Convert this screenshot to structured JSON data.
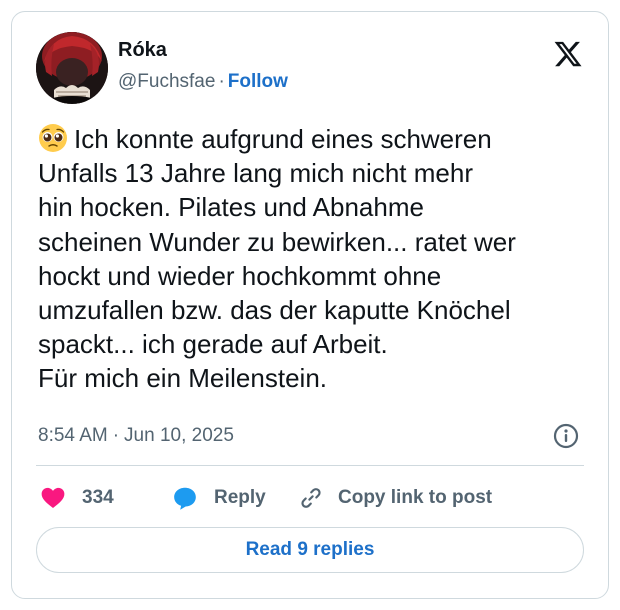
{
  "author": {
    "name": "Róka",
    "handle": "@Fuchsfae",
    "separator": "·",
    "follow_label": "Follow"
  },
  "brand_icon": "x-logo-icon",
  "tweet": {
    "emoji": "pleading-face-emoji",
    "lines": [
      "Ich konnte aufgrund eines schweren",
      "Unfalls 13 Jahre lang mich nicht mehr",
      "hin hocken. Pilates und Abnahme",
      "scheinen Wunder zu bewirken... ratet wer",
      "hockt und wieder hochkommt ohne",
      "umzufallen bzw. das der kaputte Knöchel",
      "spackt... ich gerade auf Arbeit.",
      "Für mich ein Meilenstein."
    ]
  },
  "meta": {
    "time": "8:54 AM",
    "separator": "·",
    "date": "Jun 10, 2025"
  },
  "actions": {
    "like_count": "334",
    "reply_label": "Reply",
    "copy_label": "Copy link to post"
  },
  "read_replies_label": "Read 9 replies",
  "colors": {
    "accent": "#1d70c9",
    "like": "#f91880",
    "reply_icon": "#1d9bf0",
    "muted": "#536471",
    "border": "#cfd9de"
  }
}
